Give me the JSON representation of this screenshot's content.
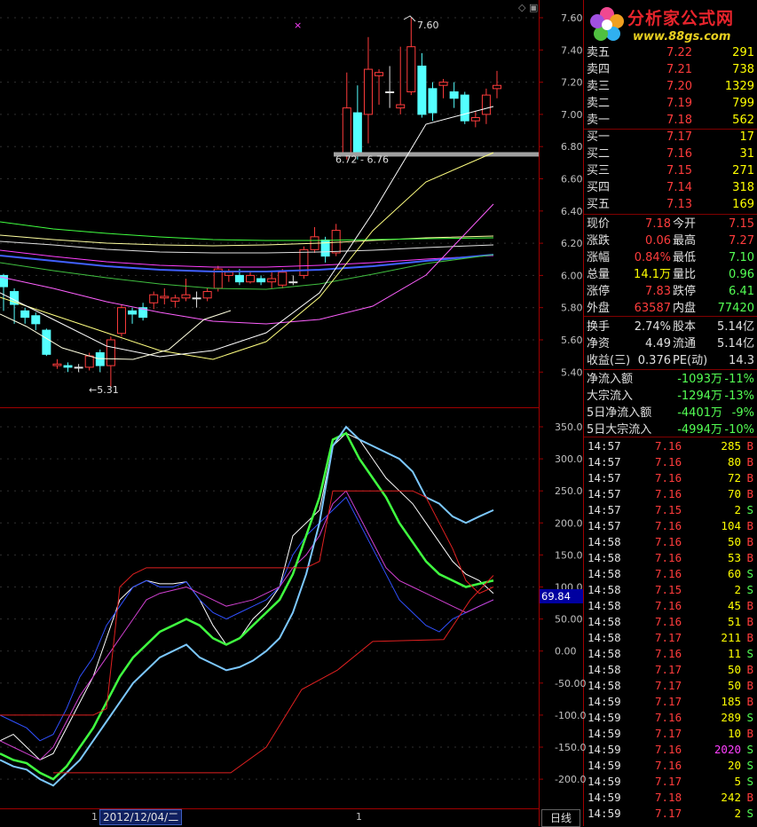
{
  "logo": {
    "brand": "分析家公式网",
    "url": "www.88gs.com"
  },
  "colors": {
    "up": "#ff3c3c",
    "down": "#54ffff",
    "flat": "#e0e0e0",
    "vol": "#ffff00",
    "purple": "#ff40ff"
  },
  "price_axis": [
    "7.60",
    "7.40",
    "7.20",
    "7.00",
    "6.80",
    "6.60",
    "6.40",
    "6.20",
    "6.00",
    "5.80",
    "5.60",
    "5.40"
  ],
  "indicator_axis": [
    "350.0",
    "300.0",
    "250.0",
    "200.0",
    "150.0",
    "100.0",
    "50.00",
    "0.00",
    "-50.00",
    "-100.0",
    "-150.0",
    "-200.0"
  ],
  "annotations": {
    "high": "7.60",
    "low": "5.31",
    "gap": "6.72 - 6.76"
  },
  "current_indicator": "69.84",
  "date_tag": "2012/12/04/二",
  "period_tab": "日线",
  "axis_marks": {
    "left": "1",
    "mid": "1"
  },
  "order_book": [
    {
      "label": "卖五",
      "price": "7.22",
      "vol": "291"
    },
    {
      "label": "卖四",
      "price": "7.21",
      "vol": "738"
    },
    {
      "label": "卖三",
      "price": "7.20",
      "vol": "1329"
    },
    {
      "label": "卖二",
      "price": "7.19",
      "vol": "799"
    },
    {
      "label": "卖一",
      "price": "7.18",
      "vol": "562"
    },
    {
      "label": "买一",
      "price": "7.17",
      "vol": "17"
    },
    {
      "label": "买二",
      "price": "7.16",
      "vol": "31"
    },
    {
      "label": "买三",
      "price": "7.15",
      "vol": "271"
    },
    {
      "label": "买四",
      "price": "7.14",
      "vol": "318"
    },
    {
      "label": "买五",
      "price": "7.13",
      "vol": "169"
    }
  ],
  "stats": [
    {
      "l1": "现价",
      "v1": "7.18",
      "c1": "#ff3c3c",
      "l2": "今开",
      "v2": "7.15",
      "c2": "#ff3c3c"
    },
    {
      "l1": "涨跌",
      "v1": "0.06",
      "c1": "#ff3c3c",
      "l2": "最高",
      "v2": "7.27",
      "c2": "#ff3c3c"
    },
    {
      "l1": "涨幅",
      "v1": "0.84%",
      "c1": "#ff3c3c",
      "l2": "最低",
      "v2": "7.10",
      "c2": "#54ff54"
    },
    {
      "l1": "总量",
      "v1": "14.1万",
      "c1": "#ffff00",
      "l2": "量比",
      "v2": "0.96",
      "c2": "#54ff54"
    },
    {
      "l1": "涨停",
      "v1": "7.83",
      "c1": "#ff3c3c",
      "l2": "跌停",
      "v2": "6.41",
      "c2": "#54ff54"
    },
    {
      "l1": "外盘",
      "v1": "63587",
      "c1": "#ff3c3c",
      "l2": "内盘",
      "v2": "77420",
      "c2": "#54ff54"
    },
    {
      "l1": "换手",
      "v1": "2.74%",
      "c1": "#e0e0e0",
      "l2": "股本",
      "v2": "5.14亿",
      "c2": "#e0e0e0"
    },
    {
      "l1": "净资",
      "v1": "4.49",
      "c1": "#e0e0e0",
      "l2": "流通",
      "v2": "5.14亿",
      "c2": "#e0e0e0"
    },
    {
      "l1": "收益(三)",
      "v1": "0.376",
      "c1": "#e0e0e0",
      "l2": "PE(动)",
      "v2": "14.3",
      "c2": "#e0e0e0"
    }
  ],
  "flows": [
    {
      "label": "净流入额",
      "value": "-1093万",
      "pct": "-11%"
    },
    {
      "label": "大宗流入",
      "value": "-1294万",
      "pct": "-13%"
    },
    {
      "label": "5日净流入额",
      "value": "-4401万",
      "pct": "-9%"
    },
    {
      "label": "5日大宗流入",
      "value": "-4994万",
      "pct": "-10%"
    }
  ],
  "ticks": [
    {
      "time": "14:57",
      "price": "7.16",
      "vol": "285",
      "dir": "B"
    },
    {
      "time": "14:57",
      "price": "7.16",
      "vol": "80",
      "dir": "B"
    },
    {
      "time": "14:57",
      "price": "7.16",
      "vol": "72",
      "dir": "B"
    },
    {
      "time": "14:57",
      "price": "7.16",
      "vol": "70",
      "dir": "B"
    },
    {
      "time": "14:57",
      "price": "7.15",
      "vol": "2",
      "dir": "S"
    },
    {
      "time": "14:57",
      "price": "7.16",
      "vol": "104",
      "dir": "B"
    },
    {
      "time": "14:58",
      "price": "7.16",
      "vol": "50",
      "dir": "B"
    },
    {
      "time": "14:58",
      "price": "7.16",
      "vol": "53",
      "dir": "B"
    },
    {
      "time": "14:58",
      "price": "7.16",
      "vol": "60",
      "dir": "S"
    },
    {
      "time": "14:58",
      "price": "7.15",
      "vol": "2",
      "dir": "S"
    },
    {
      "time": "14:58",
      "price": "7.16",
      "vol": "45",
      "dir": "B"
    },
    {
      "time": "14:58",
      "price": "7.16",
      "vol": "51",
      "dir": "B"
    },
    {
      "time": "14:58",
      "price": "7.17",
      "vol": "211",
      "dir": "B"
    },
    {
      "time": "14:58",
      "price": "7.16",
      "vol": "11",
      "dir": "S"
    },
    {
      "time": "14:58",
      "price": "7.17",
      "vol": "50",
      "dir": "B"
    },
    {
      "time": "14:58",
      "price": "7.17",
      "vol": "50",
      "dir": "B"
    },
    {
      "time": "14:59",
      "price": "7.17",
      "vol": "185",
      "dir": "B"
    },
    {
      "time": "14:59",
      "price": "7.16",
      "vol": "289",
      "dir": "S"
    },
    {
      "time": "14:59",
      "price": "7.17",
      "vol": "10",
      "dir": "B"
    },
    {
      "time": "14:59",
      "price": "7.16",
      "vol": "2020",
      "dir": "S"
    },
    {
      "time": "14:59",
      "price": "7.16",
      "vol": "20",
      "dir": "S"
    },
    {
      "time": "14:59",
      "price": "7.17",
      "vol": "5",
      "dir": "S"
    },
    {
      "time": "14:59",
      "price": "7.18",
      "vol": "242",
      "dir": "B"
    },
    {
      "time": "14:59",
      "price": "7.17",
      "vol": "2",
      "dir": "S"
    }
  ]
}
